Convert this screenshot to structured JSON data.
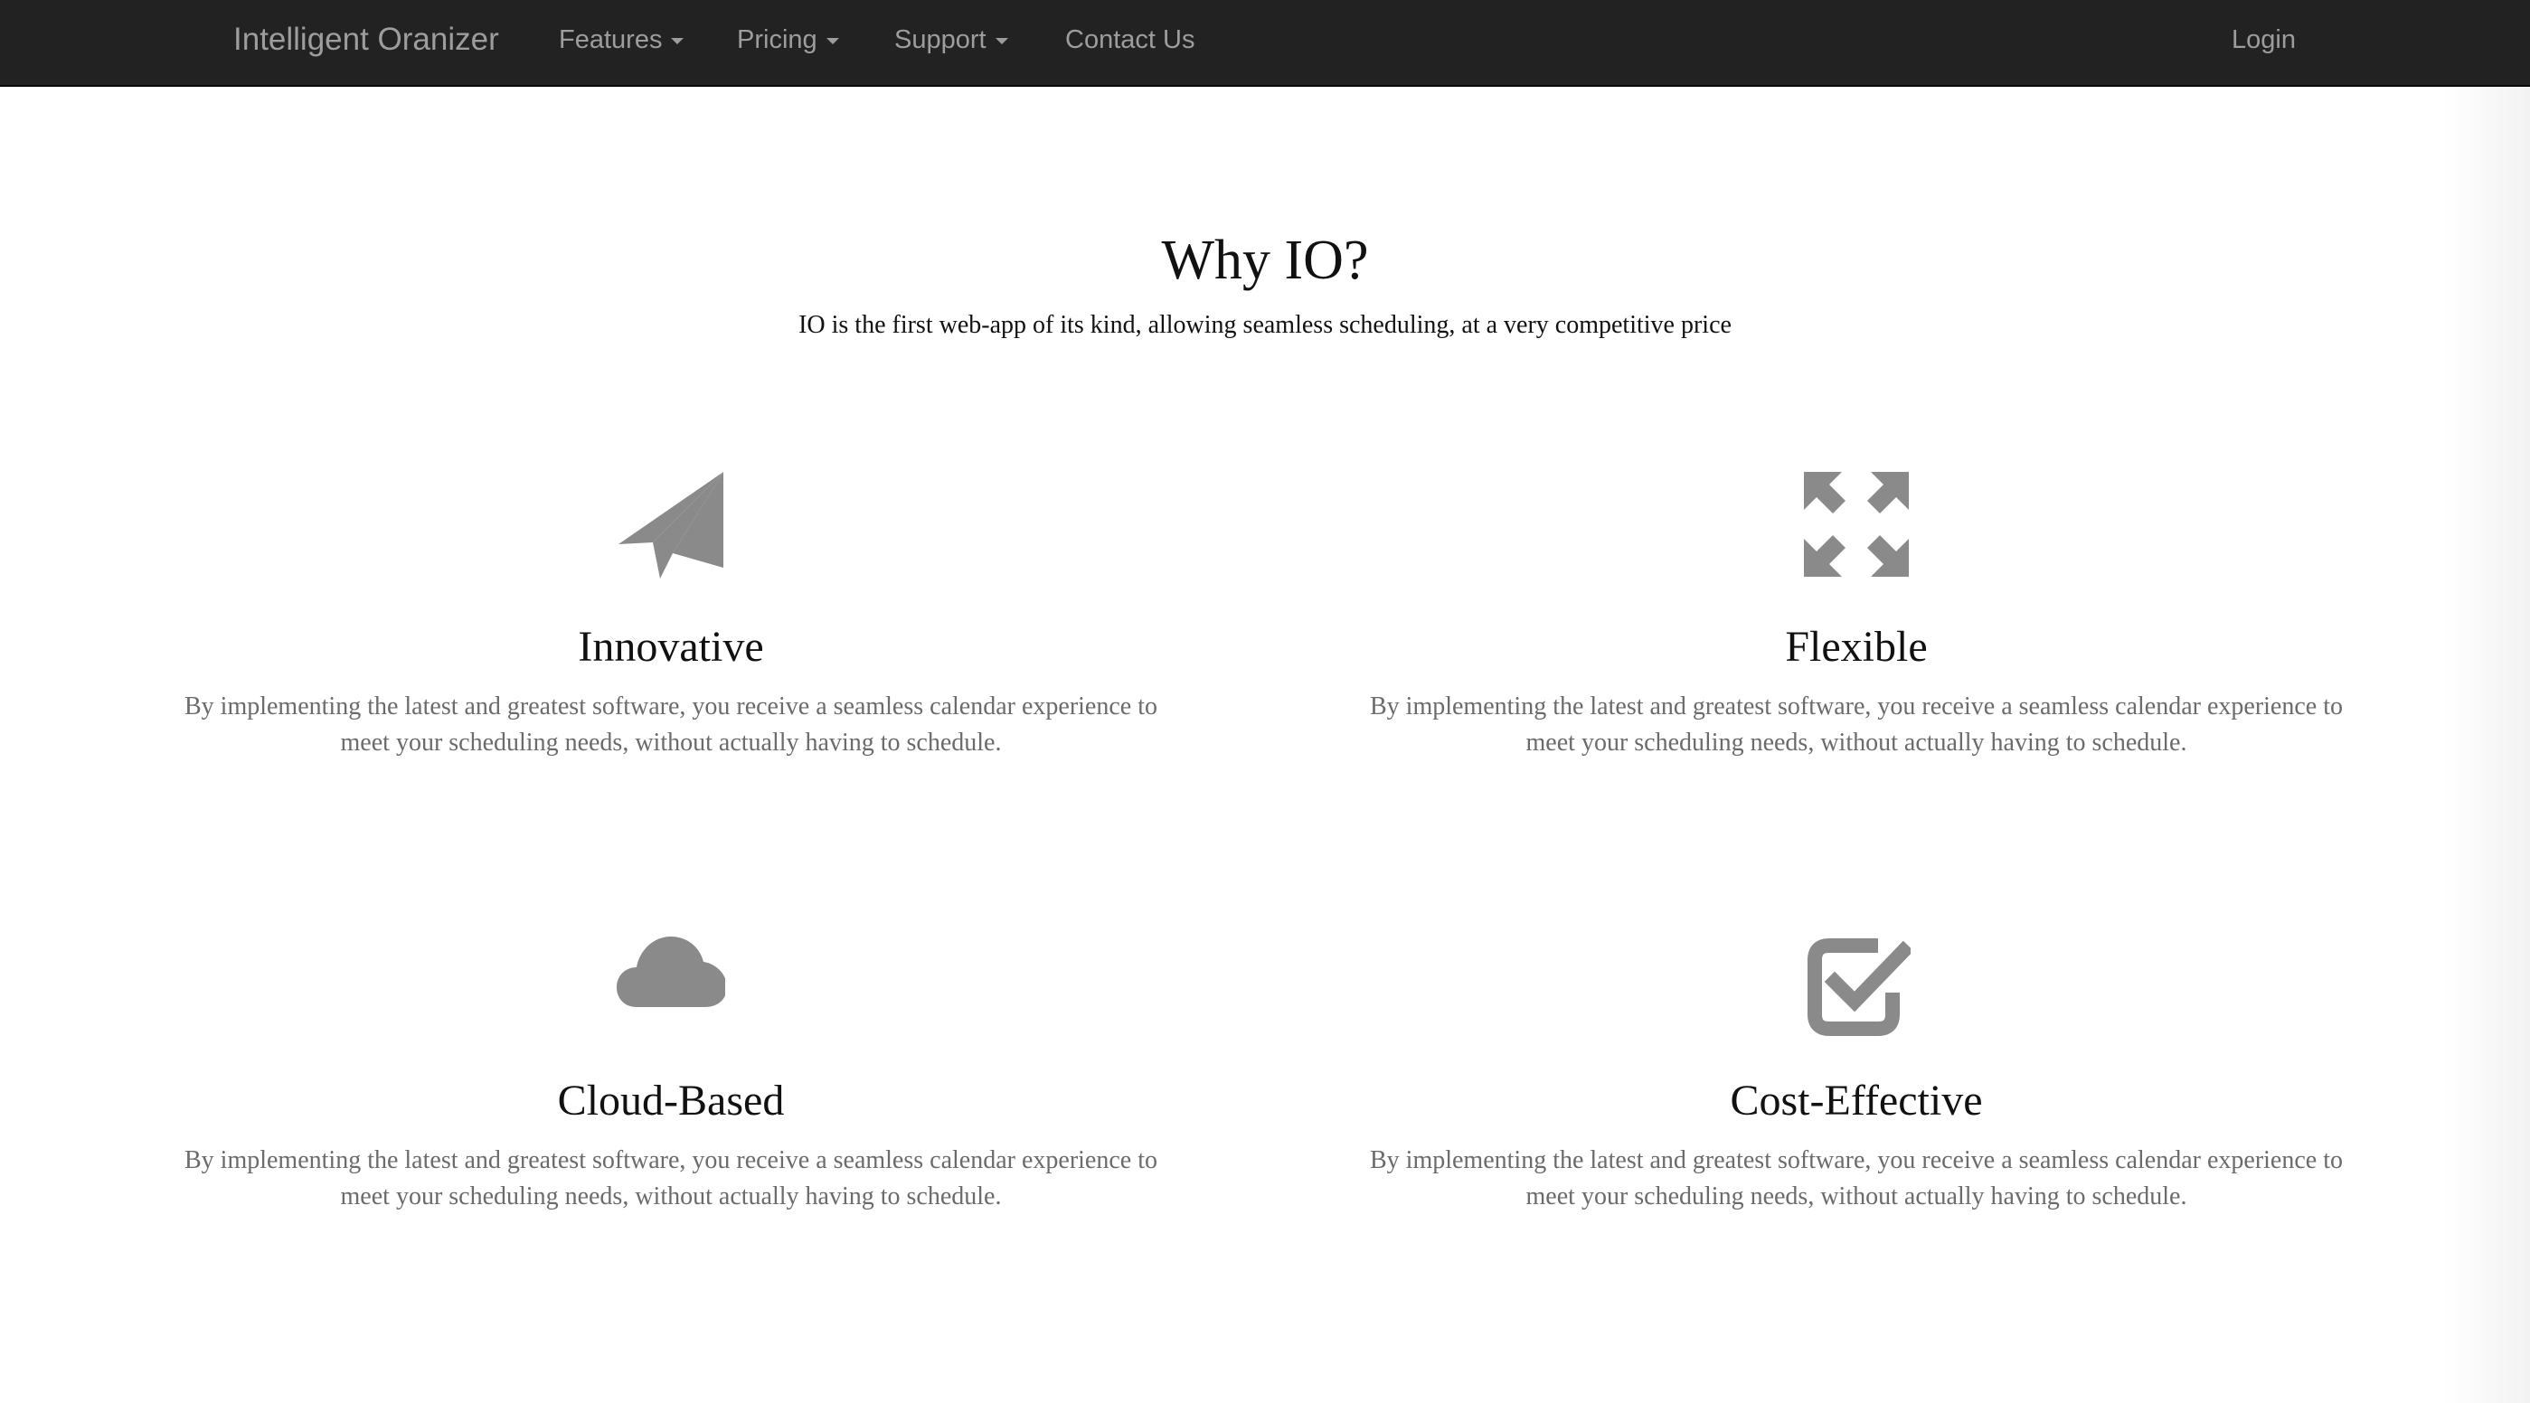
{
  "navbar": {
    "brand": "Intelligent Oranizer",
    "items": [
      {
        "label": "Features",
        "dropdown": true
      },
      {
        "label": "Pricing",
        "dropdown": true
      },
      {
        "label": "Support",
        "dropdown": true
      },
      {
        "label": "Contact Us",
        "dropdown": false
      }
    ],
    "login": "Login"
  },
  "hero": {
    "title": "Why IO?",
    "subtitle": "IO is the first web-app of its kind, allowing seamless scheduling, at a very competitive price"
  },
  "features": [
    {
      "icon": "paper-plane-icon",
      "title": "Innovative",
      "description": "By implementing the latest and greatest software, you receive a seamless calendar experience to meet your scheduling needs, without actually having to schedule."
    },
    {
      "icon": "expand-arrows-icon",
      "title": "Flexible",
      "description": "By implementing the latest and greatest software, you receive a seamless calendar experience to meet your scheduling needs, without actually having to schedule."
    },
    {
      "icon": "cloud-icon",
      "title": "Cloud-Based",
      "description": "By implementing the latest and greatest software, you receive a seamless calendar experience to meet your scheduling needs, without actually having to schedule."
    },
    {
      "icon": "checkbox-icon",
      "title": "Cost-Effective",
      "description": "By implementing the latest and greatest software, you receive a seamless calendar experience to meet your scheduling needs, without actually having to schedule."
    }
  ],
  "colors": {
    "navbar_bg": "#222222",
    "nav_text": "#9d9d9d",
    "icon": "#8a8a8a",
    "body_text": "#6b6b6b"
  }
}
